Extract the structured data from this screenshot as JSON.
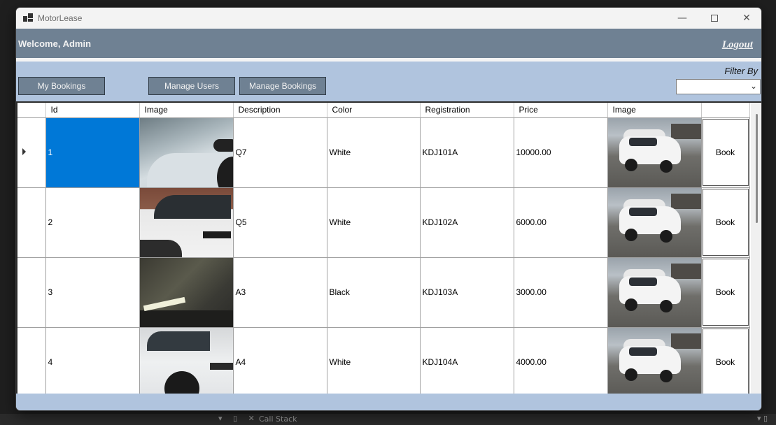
{
  "window": {
    "title": "MotorLease"
  },
  "header": {
    "welcome": "Welcome, Admin",
    "logout": "Logout"
  },
  "toolbar": {
    "my_bookings": "My Bookings",
    "manage_users": "Manage Users",
    "manage_bookings": "Manage Bookings",
    "filter_label": "Filter By",
    "filter_value": ""
  },
  "grid": {
    "columns": [
      "Id",
      "Image",
      "Description",
      "Color",
      "Registration",
      "Price",
      "Image",
      ""
    ],
    "rows": [
      {
        "id": "1",
        "description": "Q7",
        "color": "White",
        "registration": "KDJ101A",
        "price": "10000.00",
        "action": "Book"
      },
      {
        "id": "2",
        "description": "Q5",
        "color": "White",
        "registration": "KDJ102A",
        "price": "6000.00",
        "action": "Book"
      },
      {
        "id": "3",
        "description": "A3",
        "color": "Black",
        "registration": "KDJ103A",
        "price": "3000.00",
        "action": "Book"
      },
      {
        "id": "4",
        "description": "A4",
        "color": "White",
        "registration": "KDJ104A",
        "price": "4000.00",
        "action": "Book"
      }
    ]
  },
  "background": {
    "bottom_text": "Call Stack"
  },
  "colors": {
    "header_bg": "#6f8193",
    "toolbar_bg": "#b0c4de",
    "selection": "#0078d7"
  }
}
